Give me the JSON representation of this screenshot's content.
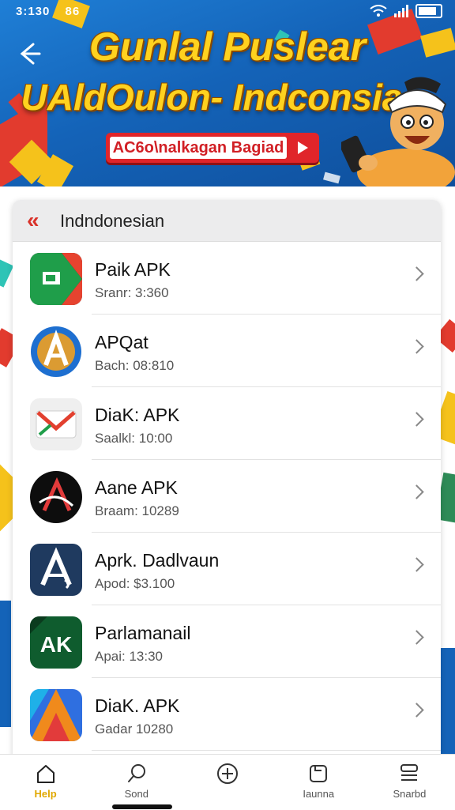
{
  "status_bar": {
    "time": "3:130",
    "extra": "86"
  },
  "banner": {
    "title_line1": "Gunlal Puslear",
    "title_line2": "UAldOulon- Indconsia",
    "button_label": "AC6o\\nalkagan Bagiad"
  },
  "list_header": {
    "title": "Indndonesian"
  },
  "apps": [
    {
      "name": "Paik APK",
      "meta": "Sranr: 3:360",
      "icon": "paik-apk-icon"
    },
    {
      "name": "APQat",
      "meta": "Bach: 08:810",
      "icon": "apqat-icon"
    },
    {
      "name": "DiaK: APK",
      "meta": "Saalkl: 10:00",
      "icon": "diak-apk-icon"
    },
    {
      "name": "Aane APK",
      "meta": "Braam: 10289",
      "icon": "aane-apk-icon"
    },
    {
      "name": "Aprk. Dadlvaun",
      "meta": "Apod: $3.100",
      "icon": "aprk-dadlvaun-icon"
    },
    {
      "name": "Parlamanail",
      "meta": "Apai: 13:30",
      "icon": "parlamanail-icon"
    },
    {
      "name": "DiaK. APK",
      "meta": "Gadar 10280",
      "icon": "diak-apk-2-icon"
    }
  ],
  "bottom_nav": [
    {
      "label": "Help",
      "icon": "home-icon",
      "active": true
    },
    {
      "label": "Sond",
      "icon": "search-icon",
      "active": false
    },
    {
      "label": "",
      "icon": "add-circle-icon",
      "active": false
    },
    {
      "label": "Iaunna",
      "icon": "downloads-icon",
      "active": false
    },
    {
      "label": "Snarbd",
      "icon": "menu-stack-icon",
      "active": false
    }
  ]
}
